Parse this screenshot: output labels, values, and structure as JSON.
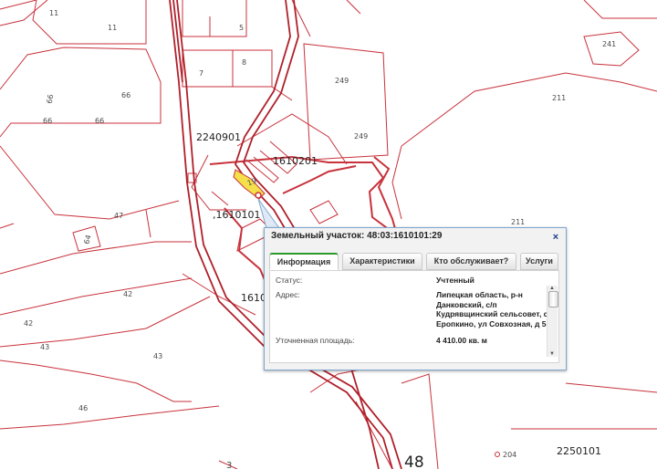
{
  "map": {
    "parcel_labels": [
      {
        "id": "l11a",
        "text": "11"
      },
      {
        "id": "l11b",
        "text": "11"
      },
      {
        "id": "l5",
        "text": "5"
      },
      {
        "id": "l7",
        "text": "7"
      },
      {
        "id": "l8",
        "text": "8"
      },
      {
        "id": "l66a",
        "text": "66"
      },
      {
        "id": "l66b",
        "text": "66"
      },
      {
        "id": "l66c",
        "text": "66"
      },
      {
        "id": "l66d",
        "text": "66"
      },
      {
        "id": "l249a",
        "text": "249"
      },
      {
        "id": "l249b",
        "text": "249"
      },
      {
        "id": "l241",
        "text": "241"
      },
      {
        "id": "l211a",
        "text": "211"
      },
      {
        "id": "l211b",
        "text": "211"
      },
      {
        "id": "l47",
        "text": "47"
      },
      {
        "id": "l64",
        "text": "64"
      },
      {
        "id": "l42a",
        "text": "42"
      },
      {
        "id": "l42b",
        "text": "42"
      },
      {
        "id": "l43a",
        "text": "43"
      },
      {
        "id": "l43b",
        "text": "43"
      },
      {
        "id": "l46",
        "text": "46"
      },
      {
        "id": "l19",
        "text": "19"
      },
      {
        "id": "l204",
        "text": "204"
      },
      {
        "id": "l3",
        "text": "3"
      }
    ],
    "quarter_labels": [
      {
        "id": "q2240901",
        "text": "2240901"
      },
      {
        "id": "q1610201",
        "text": "1610201"
      },
      {
        "id": "q1610101",
        "text": ",1610101"
      },
      {
        "id": "q1610",
        "text": "1610"
      },
      {
        "id": "q2250101",
        "text": "2250101"
      }
    ],
    "big_label": "48"
  },
  "popup": {
    "title": "Земельный участок: 48:03:1610101:29",
    "close_label": "×",
    "tabs": [
      {
        "label": "Информация",
        "active": true
      },
      {
        "label": "Характеристики",
        "active": false
      },
      {
        "label": "Кто обслуживает?",
        "active": false
      },
      {
        "label": "Услуги",
        "active": false
      }
    ],
    "fields": {
      "status_label": "Статус:",
      "status_value": "Учтенный",
      "address_label": "Адрес:",
      "address_value": "Липецкая область, р-н Данковский, с/п Кудрявщинский сельсовет, с Еропкино, ул Совхозная, д 5",
      "area_label": "Уточненная площадь:",
      "area_value": "4 410.00 кв. м"
    }
  },
  "colors": {
    "parcel_line": "#c8323c",
    "road_line": "#b0202a",
    "highlight": "#f4e04a",
    "tab_accent": "#2e9b2e"
  }
}
